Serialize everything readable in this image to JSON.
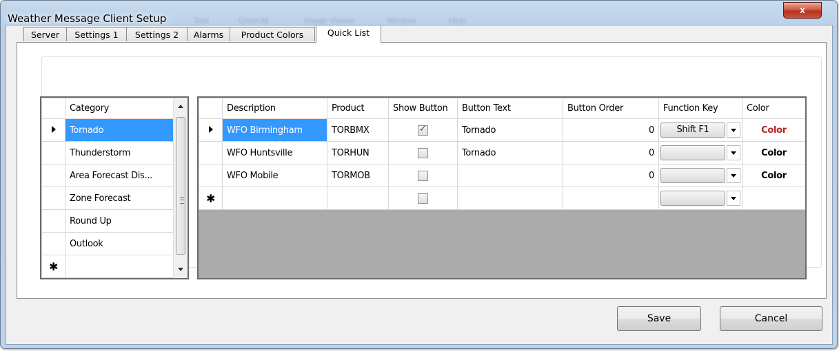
{
  "window": {
    "title": "Weather Message Client Setup",
    "close_glyph": "x"
  },
  "background_menu": [
    "Tool",
    "Grid/Util",
    "Image Viewer",
    "Window",
    "Help"
  ],
  "tabs": [
    {
      "label": "Server",
      "active": false
    },
    {
      "label": "Settings 1",
      "active": false
    },
    {
      "label": "Settings 2",
      "active": false
    },
    {
      "label": "Alarms",
      "active": false
    },
    {
      "label": "Product Colors",
      "active": false
    },
    {
      "label": "Quick List",
      "active": true
    }
  ],
  "category_grid": {
    "header": "Category",
    "rows": [
      "Tornado",
      "Thunderstorm",
      "Area Forecast Dis...",
      "Zone Forecast",
      "Round Up",
      "Outlook"
    ],
    "selected_index": 0,
    "new_row_glyph": "✱"
  },
  "product_grid": {
    "headers": {
      "description": "Description",
      "product": "Product",
      "show_button": "Show Button",
      "button_text": "Button Text",
      "button_order": "Button Order",
      "function_key": "Function Key",
      "color": "Color"
    },
    "rows": [
      {
        "description": "WFO Birmingham",
        "product": "TORBMX",
        "show_button": true,
        "button_text": "Tornado",
        "button_order": "0",
        "function_key": "Shift F1",
        "color": "Color",
        "color_hex": "#b22222"
      },
      {
        "description": "WFO Huntsville",
        "product": "TORHUN",
        "show_button": false,
        "button_text": "Tornado",
        "button_order": "0",
        "function_key": "",
        "color": "Color",
        "color_hex": "#000000"
      },
      {
        "description": "WFO Mobile",
        "product": "TORMOB",
        "show_button": false,
        "button_text": "",
        "button_order": "0",
        "function_key": "",
        "color": "Color",
        "color_hex": "#000000"
      }
    ],
    "new_row_glyph": "✱"
  },
  "buttons": {
    "save": "Save",
    "cancel": "Cancel"
  },
  "colors": {
    "selection": "#3399ff",
    "grid_background": "#ababab"
  }
}
